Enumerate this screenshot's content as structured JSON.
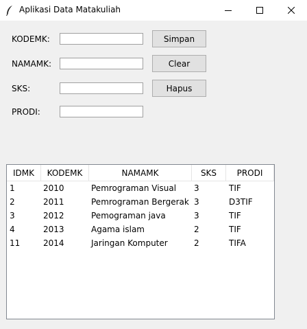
{
  "window": {
    "title": "Aplikasi Data Matakuliah",
    "icon": "feather-icon",
    "controls": [
      "minimize-icon",
      "maximize-icon",
      "close-icon"
    ]
  },
  "form": {
    "kodemk_label": "KODEMK:",
    "namamk_label": "NAMAMK:",
    "sks_label": "SKS:",
    "prodi_label": "PRODI:",
    "kodemk_value": "",
    "namamk_value": "",
    "sks_value": "",
    "prodi_value": ""
  },
  "buttons": {
    "simpan": "Simpan",
    "clear": "Clear",
    "hapus": "Hapus"
  },
  "table": {
    "columns": [
      "IDMK",
      "KODEMK",
      "NAMAMK",
      "SKS",
      "PRODI"
    ],
    "rows": [
      [
        "1",
        "2010",
        "Pemrograman Visual",
        "3",
        "TIF"
      ],
      [
        "2",
        "2011",
        "Pemrograman Bergerak",
        "3",
        "D3TIF"
      ],
      [
        "3",
        "2012",
        "Pemograman java",
        "3",
        "TIF"
      ],
      [
        "4",
        "2013",
        "Agama islam",
        "2",
        "TIF"
      ],
      [
        "11",
        "2014",
        "Jaringan Komputer",
        "2",
        "TIFA"
      ]
    ]
  }
}
